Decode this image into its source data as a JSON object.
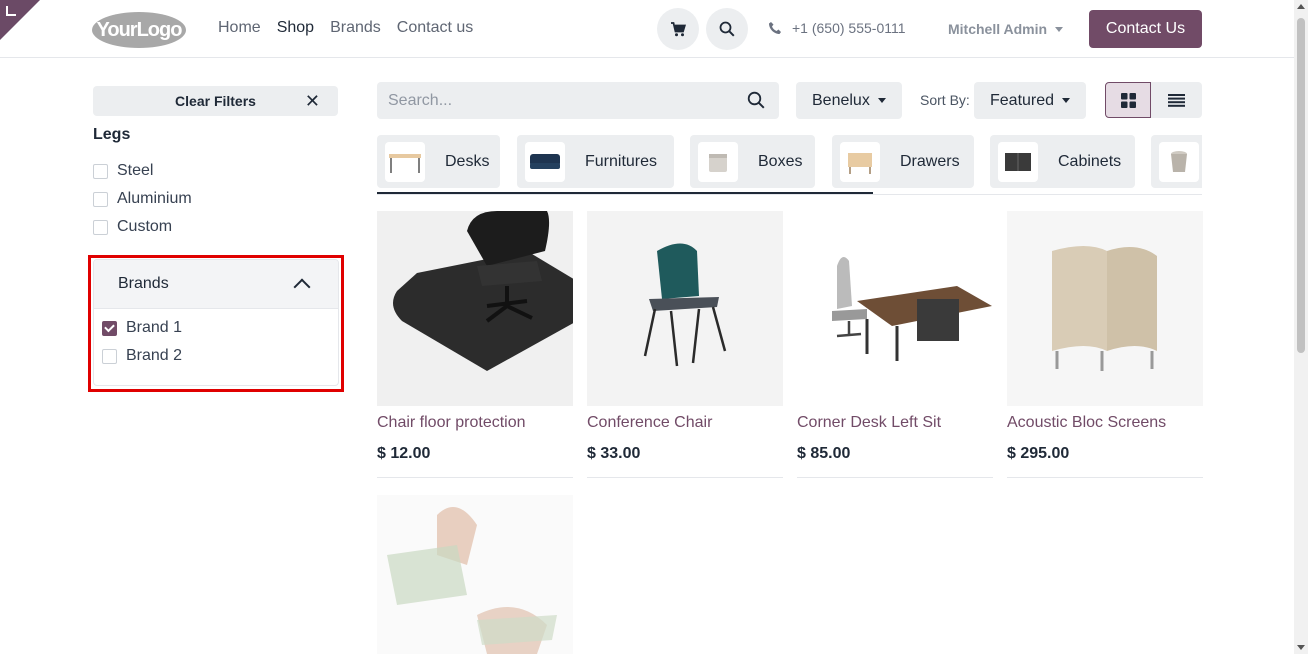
{
  "header": {
    "logo_text": "YourLogo",
    "nav": [
      "Home",
      "Shop",
      "Brands",
      "Contact us"
    ],
    "active_nav": "Shop",
    "phone": "+1 (650) 555-0111",
    "user": "Mitchell Admin",
    "contact_button": "Contact Us"
  },
  "sidebar": {
    "clear_filters": "Clear Filters",
    "legs": {
      "title": "Legs",
      "options": [
        {
          "label": "Steel",
          "checked": false
        },
        {
          "label": "Aluminium",
          "checked": false
        },
        {
          "label": "Custom",
          "checked": false
        }
      ]
    },
    "brands": {
      "title": "Brands",
      "options": [
        {
          "label": "Brand 1",
          "checked": true
        },
        {
          "label": "Brand 2",
          "checked": false
        }
      ]
    }
  },
  "toolbar": {
    "search_placeholder": "Search...",
    "pricelist": "Benelux",
    "sort_label": "Sort By:",
    "sort_value": "Featured"
  },
  "categories": [
    "Desks",
    "Furnitures",
    "Boxes",
    "Drawers",
    "Cabinets"
  ],
  "products": [
    {
      "name": "Chair floor protection",
      "price": "$ 12.00"
    },
    {
      "name": "Conference Chair",
      "price": "$ 33.00"
    },
    {
      "name": "Corner Desk Left Sit",
      "price": "$ 85.00"
    },
    {
      "name": "Acoustic Bloc Screens",
      "price": "$ 295.00"
    }
  ],
  "colors": {
    "brand": "#714b67",
    "highlight": "#e00000"
  }
}
